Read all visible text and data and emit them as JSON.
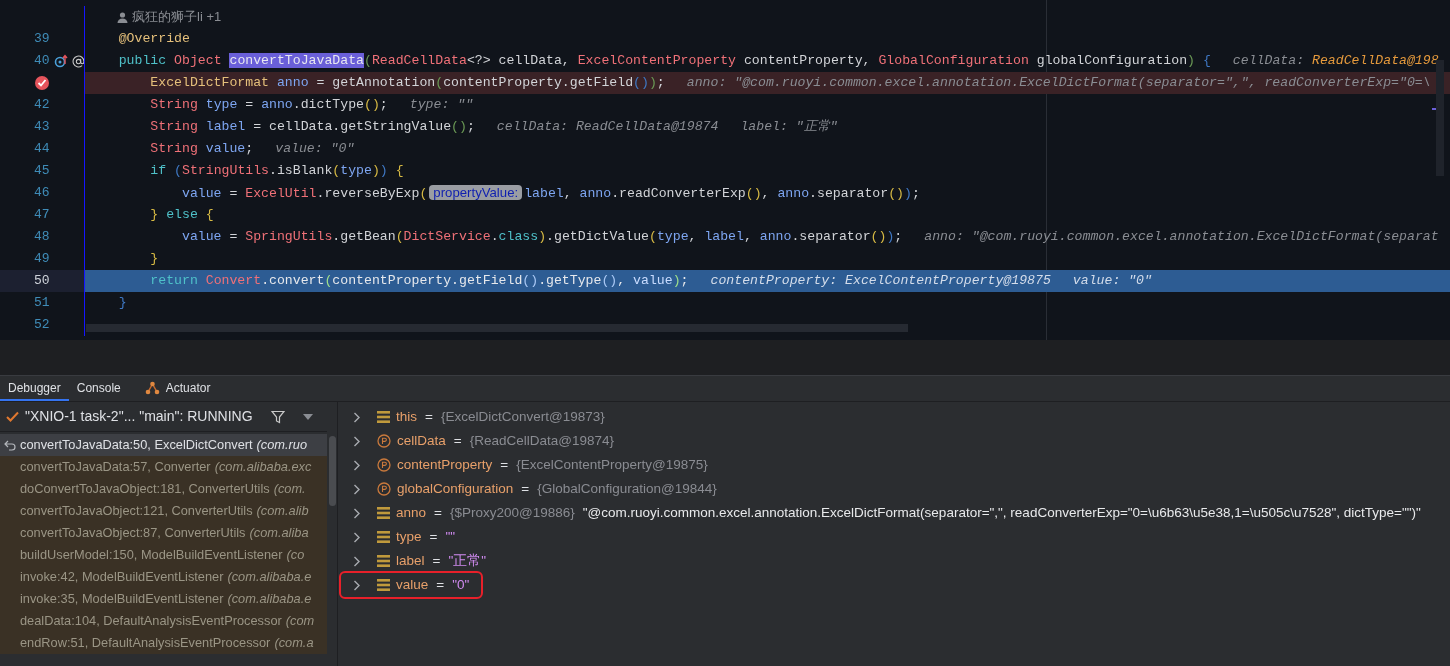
{
  "editor": {
    "author": "疯狂的狮子li +1",
    "lines": [
      {
        "number": "39",
        "tokens": [
          {
            "text": "    @Override",
            "kind": "ann"
          }
        ]
      },
      {
        "number": "40",
        "overrides": true,
        "tokens": [
          {
            "text": "    public ",
            "kind": "kw"
          },
          {
            "text": "Object ",
            "kind": "type"
          },
          {
            "text": "convertToJavaData",
            "kind": "hl"
          },
          {
            "text": "(",
            "kind": "pg"
          },
          {
            "text": "ReadCellData",
            "kind": "type"
          },
          {
            "text": "<?> cellData, ",
            "kind": "plain"
          },
          {
            "text": "ExcelContentProperty",
            "kind": "type"
          },
          {
            "text": " contentProperty, ",
            "kind": "plain"
          },
          {
            "text": "GlobalConfiguration",
            "kind": "type"
          },
          {
            "text": " globalConfiguration",
            "kind": "plain"
          },
          {
            "text": ")",
            "kind": "pg"
          },
          {
            "text": " {",
            "kind": "pb"
          }
        ],
        "hints": [
          {
            "label": "cellData:",
            "value": "ReadCellData@198"
          }
        ]
      },
      {
        "breakpoint": true,
        "tokens": [
          {
            "text": "        ExcelDictFormat ",
            "kind": "ann"
          },
          {
            "text": "anno",
            "kind": "var"
          },
          {
            "text": " = getAnnotation",
            "kind": "plain"
          },
          {
            "text": "(",
            "kind": "pg"
          },
          {
            "text": "contentProperty.getField",
            "kind": "plain"
          },
          {
            "text": "()",
            "kind": "pb"
          },
          {
            "text": ")",
            "kind": "pg"
          },
          {
            "text": ";",
            "kind": "plain"
          }
        ],
        "hints": [
          {
            "label": "anno: \"@com.ruoyi.common.excel.annotation.ExcelDictFormat(separator=\",\", readConverterExp=\"0=\\"
          }
        ]
      },
      {
        "number": "42",
        "tokens": [
          {
            "text": "        String ",
            "kind": "type"
          },
          {
            "text": "type",
            "kind": "var"
          },
          {
            "text": " = ",
            "kind": "plain"
          },
          {
            "text": "anno",
            "kind": "var"
          },
          {
            "text": ".dictType",
            "kind": "plain"
          },
          {
            "text": "()",
            "kind": "py"
          },
          {
            "text": ";",
            "kind": "plain"
          }
        ],
        "hints": [
          {
            "label": "type: \"\""
          }
        ]
      },
      {
        "number": "43",
        "tokens": [
          {
            "text": "        String ",
            "kind": "type"
          },
          {
            "text": "label",
            "kind": "var"
          },
          {
            "text": " = cellData.getStringValue",
            "kind": "plain"
          },
          {
            "text": "()",
            "kind": "pg"
          },
          {
            "text": ";",
            "kind": "plain"
          }
        ],
        "hints": [
          {
            "label": "cellData: ReadCellData@19874"
          },
          {
            "label": "label: \"正常\""
          }
        ]
      },
      {
        "number": "44",
        "tokens": [
          {
            "text": "        String ",
            "kind": "type"
          },
          {
            "text": "value",
            "kind": "var"
          },
          {
            "text": ";",
            "kind": "plain"
          }
        ],
        "hints": [
          {
            "label": "value: \"0\""
          }
        ]
      },
      {
        "number": "45",
        "tokens": [
          {
            "text": "        if ",
            "kind": "kw"
          },
          {
            "text": "(",
            "kind": "pb"
          },
          {
            "text": "StringUtils",
            "kind": "type"
          },
          {
            "text": ".isBlank",
            "kind": "plain"
          },
          {
            "text": "(",
            "kind": "py"
          },
          {
            "text": "type",
            "kind": "var"
          },
          {
            "text": ")",
            "kind": "py"
          },
          {
            "text": ")",
            "kind": "pb"
          },
          {
            "text": " {",
            "kind": "py"
          }
        ]
      },
      {
        "number": "46",
        "tokens": [
          {
            "text": "            value",
            "kind": "var"
          },
          {
            "text": " = ",
            "kind": "plain"
          },
          {
            "text": "ExcelUtil",
            "kind": "type"
          },
          {
            "text": ".reverseByExp",
            "kind": "plain"
          },
          {
            "text": "(",
            "kind": "py"
          },
          {
            "text": "propertyValue:",
            "kind": "inlay"
          },
          {
            "text": "label",
            "kind": "var"
          },
          {
            "text": ", ",
            "kind": "plain"
          },
          {
            "text": "anno",
            "kind": "var"
          },
          {
            "text": ".readConverterExp",
            "kind": "plain"
          },
          {
            "text": "()",
            "kind": "py"
          },
          {
            "text": ", ",
            "kind": "plain"
          },
          {
            "text": "anno",
            "kind": "var"
          },
          {
            "text": ".separator",
            "kind": "plain"
          },
          {
            "text": "()",
            "kind": "py"
          },
          {
            "text": ")",
            "kind": "pb"
          },
          {
            "text": ";",
            "kind": "plain"
          }
        ]
      },
      {
        "number": "47",
        "tokens": [
          {
            "text": "        } ",
            "kind": "py"
          },
          {
            "text": "else ",
            "kind": "kw"
          },
          {
            "text": "{",
            "kind": "py"
          }
        ]
      },
      {
        "number": "48",
        "tokens": [
          {
            "text": "            value",
            "kind": "var"
          },
          {
            "text": " = ",
            "kind": "plain"
          },
          {
            "text": "SpringUtils",
            "kind": "type"
          },
          {
            "text": ".getBean",
            "kind": "plain"
          },
          {
            "text": "(",
            "kind": "py"
          },
          {
            "text": "DictService",
            "kind": "type"
          },
          {
            "text": ".",
            "kind": "plain"
          },
          {
            "text": "class",
            "kind": "kw"
          },
          {
            "text": ")",
            "kind": "py"
          },
          {
            "text": ".getDictValue",
            "kind": "plain"
          },
          {
            "text": "(",
            "kind": "py"
          },
          {
            "text": "type",
            "kind": "var"
          },
          {
            "text": ", ",
            "kind": "plain"
          },
          {
            "text": "label",
            "kind": "var"
          },
          {
            "text": ", ",
            "kind": "plain"
          },
          {
            "text": "anno",
            "kind": "var"
          },
          {
            "text": ".separator",
            "kind": "plain"
          },
          {
            "text": "()",
            "kind": "py"
          },
          {
            "text": ")",
            "kind": "pb"
          },
          {
            "text": ";",
            "kind": "plain"
          }
        ],
        "hints": [
          {
            "label": "anno: \"@com.ruoyi.common.excel.annotation.ExcelDictFormat(separat"
          }
        ]
      },
      {
        "number": "49",
        "tokens": [
          {
            "text": "        }",
            "kind": "py"
          }
        ]
      },
      {
        "number": "50",
        "execution_point": true,
        "tokens": [
          {
            "text": "        return ",
            "kind": "kw"
          },
          {
            "text": "Convert",
            "kind": "type"
          },
          {
            "text": ".convert",
            "kind": "plain"
          },
          {
            "text": "(",
            "kind": "pg"
          },
          {
            "text": "contentProperty.getField",
            "kind": "plain"
          },
          {
            "text": "()",
            "kind": "pb"
          },
          {
            "text": ".getType",
            "kind": "plain"
          },
          {
            "text": "()",
            "kind": "pb"
          },
          {
            "text": ", ",
            "kind": "plain"
          },
          {
            "text": "value",
            "kind": "var"
          },
          {
            "text": ")",
            "kind": "pg"
          },
          {
            "text": ";",
            "kind": "plain"
          }
        ],
        "hints": [
          {
            "label": "contentProperty: ExcelContentProperty@19875"
          },
          {
            "label": "value: \"0\""
          }
        ]
      },
      {
        "number": "51",
        "tokens": [
          {
            "text": "    }",
            "kind": "pb"
          }
        ]
      },
      {
        "number": "52"
      }
    ]
  },
  "tool_window": {
    "tabs": [
      {
        "label": "Debugger",
        "selected": true,
        "icon": false
      },
      {
        "label": "Console",
        "selected": false,
        "icon": false
      },
      {
        "label": "Actuator",
        "selected": false,
        "icon": true
      }
    ],
    "thread": {
      "text": "\"XNIO-1 task-2\"... \"main\": RUNNING"
    },
    "frames": [
      {
        "method": "convertToJavaData:50, ExcelDictConvert",
        "package": "(com.ruo",
        "selected": true
      },
      {
        "method": "convertToJavaData:57, Converter",
        "package": "(com.alibaba.exc",
        "selected": false
      },
      {
        "method": "doConvertToJavaObject:181, ConverterUtils",
        "package": "(com.",
        "selected": false
      },
      {
        "method": "convertToJavaObject:121, ConverterUtils",
        "package": "(com.alib",
        "selected": false
      },
      {
        "method": "convertToJavaObject:87, ConverterUtils",
        "package": "(com.aliba",
        "selected": false
      },
      {
        "method": "buildUserModel:150, ModelBuildEventListener",
        "package": "(co",
        "selected": false
      },
      {
        "method": "invoke:42, ModelBuildEventListener",
        "package": "(com.alibaba.e",
        "selected": false
      },
      {
        "method": "invoke:35, ModelBuildEventListener",
        "package": "(com.alibaba.e",
        "selected": false
      },
      {
        "method": "dealData:104, DefaultAnalysisEventProcessor",
        "package": "(com",
        "selected": false
      },
      {
        "method": "endRow:51, DefaultAnalysisEventProcessor",
        "package": "(com.a",
        "selected": false
      }
    ],
    "variables": [
      {
        "kind": "field",
        "name": "this",
        "separator": "=",
        "ref": "{ExcelDictConvert@19873}",
        "boxed": false
      },
      {
        "kind": "param",
        "name": "cellData",
        "separator": "=",
        "ref": "{ReadCellData@19874}",
        "boxed": false
      },
      {
        "kind": "param",
        "name": "contentProperty",
        "separator": "=",
        "ref": "{ExcelContentProperty@19875}",
        "boxed": false
      },
      {
        "kind": "param",
        "name": "globalConfiguration",
        "separator": "=",
        "ref": "{GlobalConfiguration@19844}",
        "boxed": false
      },
      {
        "kind": "field",
        "name": "anno",
        "separator": "=",
        "ref": "{$Proxy200@19886}",
        "text": "\"@com.ruoyi.common.excel.annotation.ExcelDictFormat(separator=\",\", readConverterExp=\"0=\\u6b63\\u5e38,1=\\u505c\\u7528\", dictType=\"\")\"",
        "boxed": false
      },
      {
        "kind": "field",
        "name": "type",
        "separator": "=",
        "string": "\"\"",
        "boxed": false
      },
      {
        "kind": "field",
        "name": "label",
        "separator": "=",
        "string": "\"正常\"",
        "boxed": false
      },
      {
        "kind": "field",
        "name": "value",
        "separator": "=",
        "string": "\"0\"",
        "boxed": true
      }
    ]
  }
}
